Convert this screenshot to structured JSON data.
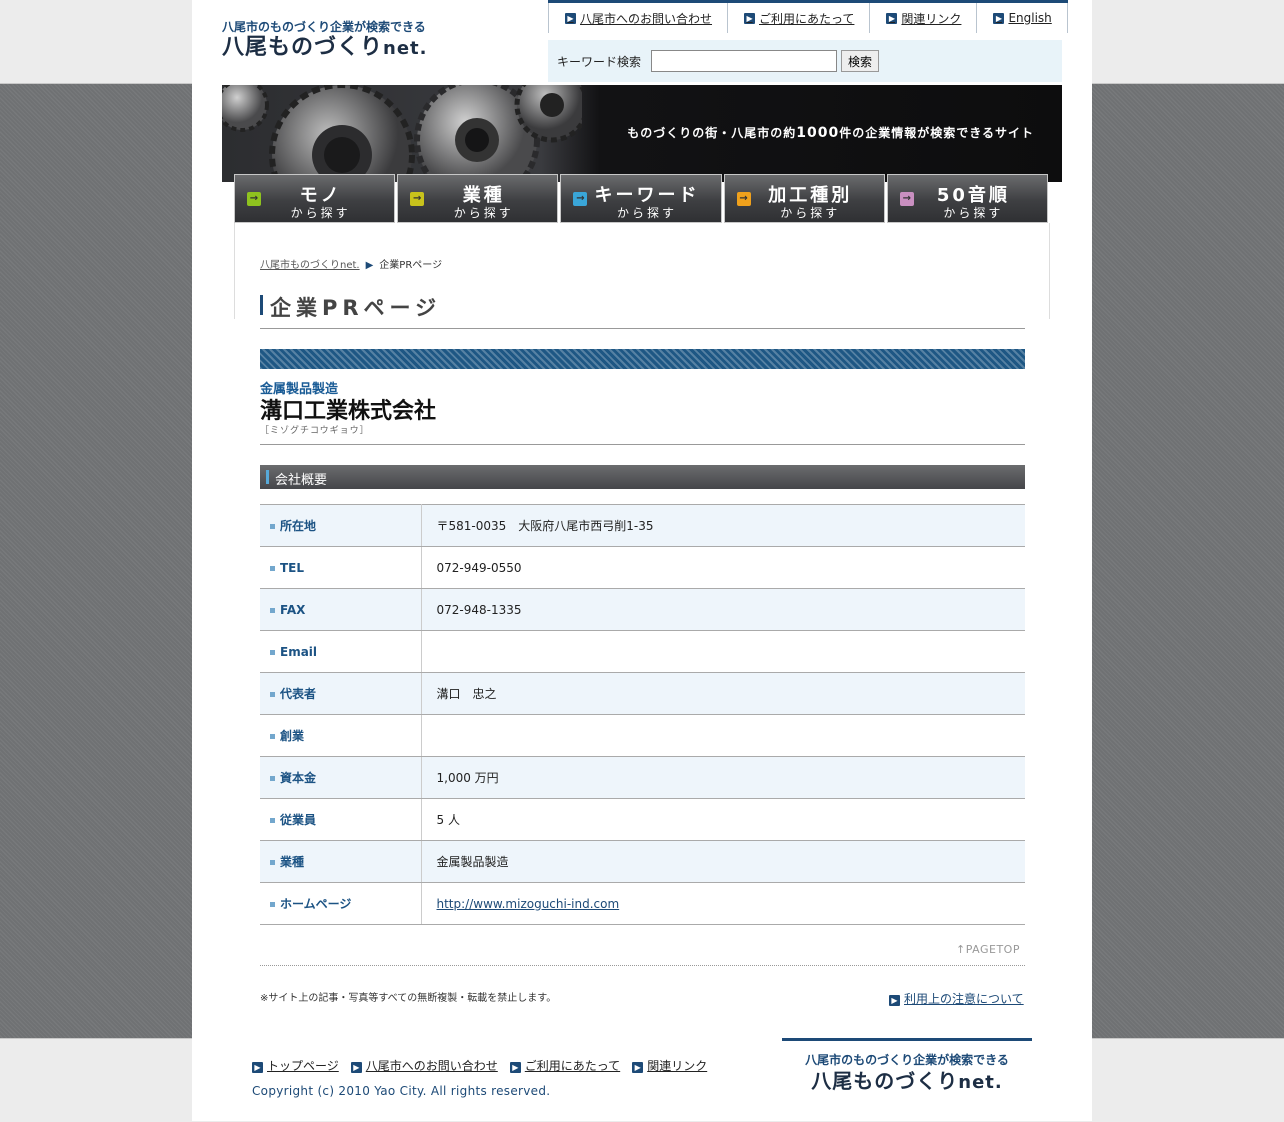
{
  "logo": {
    "tagline": "八尾市のものづくり企業が検索できる",
    "main": "八尾ものづくり",
    "suffix": "net."
  },
  "topnav": [
    {
      "label": "八尾市へのお問い合わせ"
    },
    {
      "label": "ご利用にあたって"
    },
    {
      "label": "関連リンク"
    },
    {
      "label": "English"
    }
  ],
  "search": {
    "label": "キーワード検索",
    "value": "",
    "button": "検索"
  },
  "banner": {
    "text_pre": "ものづくりの街・八尾市の約",
    "text_num": "1000",
    "text_post": "件の企業情報が検索できるサイト"
  },
  "mainnav": [
    {
      "big": "モノ",
      "small": "から探す",
      "icon_color": "#8fc31f"
    },
    {
      "big": "業種",
      "small": "から探す",
      "icon_color": "#c8c21c"
    },
    {
      "big": "キーワード",
      "small": "から探す",
      "icon_color": "#3aa6d8"
    },
    {
      "big": "加工種別",
      "small": "から探す",
      "icon_color": "#f0a11c"
    },
    {
      "big": "50音順",
      "small": "から探す",
      "icon_color": "#c98fc0"
    }
  ],
  "breadcrumb": {
    "home": "八尾市ものづくりnet.",
    "current": "企業PRページ"
  },
  "page_title": "企業PRページ",
  "company": {
    "category": "金属製品製造",
    "name": "溝口工業株式会社",
    "kana": "［ミゾグチコウギョウ］"
  },
  "section_title": "会社概要",
  "info": {
    "rows": [
      {
        "label": "所在地",
        "value": "〒581-0035　大阪府八尾市西弓削1-35"
      },
      {
        "label": "TEL",
        "value": "072-949-0550"
      },
      {
        "label": "FAX",
        "value": "072-948-1335"
      },
      {
        "label": "Email",
        "value": ""
      },
      {
        "label": "代表者",
        "value": "溝口　忠之"
      },
      {
        "label": "創業",
        "value": ""
      },
      {
        "label": "資本金",
        "value": "1,000 万円"
      },
      {
        "label": "従業員",
        "value": "5 人"
      },
      {
        "label": "業種",
        "value": "金属製品製造"
      },
      {
        "label": "ホームページ",
        "value": "http://www.mizoguchi-ind.com"
      }
    ]
  },
  "pagetop": "PAGETOP",
  "notice": "※サイト上の記事・写真等すべての無断複製・転載を禁止します。",
  "terms_link": "利用上の注意について",
  "footer": {
    "nav": [
      {
        "label": "トップページ"
      },
      {
        "label": "八尾市へのお問い合わせ"
      },
      {
        "label": "ご利用にあたって"
      },
      {
        "label": "関連リンク"
      }
    ],
    "copyright": "Copyright (c) 2010 Yao City. All rights reserved."
  }
}
